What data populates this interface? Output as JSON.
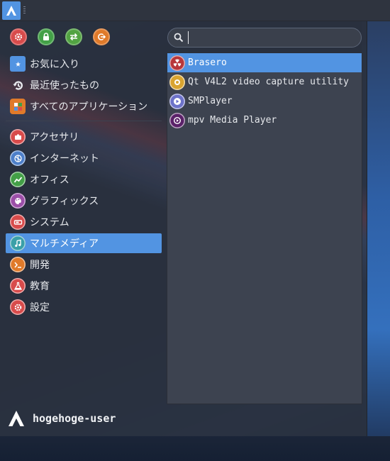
{
  "search": {
    "value": "",
    "placeholder": ""
  },
  "system_buttons": [
    {
      "name": "settings-button",
      "icon": "gear-icon",
      "color": "#d84b4b"
    },
    {
      "name": "lock-screen-button",
      "icon": "lock-icon",
      "color": "#43a047"
    },
    {
      "name": "switch-user-button",
      "icon": "switch-arrows-icon",
      "color": "#52a342"
    },
    {
      "name": "logout-button",
      "icon": "logout-icon",
      "color": "#e07a2a"
    }
  ],
  "places": [
    {
      "label": "お気に入り",
      "icon": "favorites-folder-icon",
      "color": "#5294e2"
    },
    {
      "label": "最近使ったもの",
      "icon": "recent-history-icon",
      "color": "#e6e8ec"
    },
    {
      "label": "すべてのアプリケーション",
      "icon": "all-apps-grid-icon",
      "color": "#e07a2a"
    }
  ],
  "categories": [
    {
      "label": "アクセサリ",
      "icon": "accessories-icon",
      "color": "#d84b4b"
    },
    {
      "label": "インターネット",
      "icon": "internet-globe-icon",
      "color": "#4d7fc9"
    },
    {
      "label": "オフィス",
      "icon": "office-chart-icon",
      "color": "#43a047"
    },
    {
      "label": "グラフィックス",
      "icon": "graphics-palette-icon",
      "color": "#9c4fa8"
    },
    {
      "label": "システム",
      "icon": "system-icon",
      "color": "#d84b4b"
    },
    {
      "label": "マルチメディア",
      "icon": "multimedia-icon",
      "color": "#3aa0a8",
      "active": true
    },
    {
      "label": "開発",
      "icon": "development-icon",
      "color": "#e07a2a"
    },
    {
      "label": "教育",
      "icon": "education-flask-icon",
      "color": "#d84b4b"
    },
    {
      "label": "設定",
      "icon": "settings-gear-icon",
      "color": "#d84b4b"
    }
  ],
  "apps": [
    {
      "label": "Brasero",
      "icon": "brasero-disc-icon",
      "color": "#b8373b",
      "active": true
    },
    {
      "label": "Qt V4L2 video capture utility",
      "icon": "webcam-icon",
      "color": "#d9a430"
    },
    {
      "label": "SMPlayer",
      "icon": "smplayer-icon",
      "color": "#6d72c9"
    },
    {
      "label": "mpv Media Player",
      "icon": "mpv-icon",
      "color": "#5b2169"
    }
  ],
  "user": {
    "name": "hogehoge-user"
  },
  "colors": {
    "accent": "#5294e2",
    "panel": "#2f343f",
    "menu_bg": "#2a303d",
    "list_bg": "#3d4350"
  }
}
